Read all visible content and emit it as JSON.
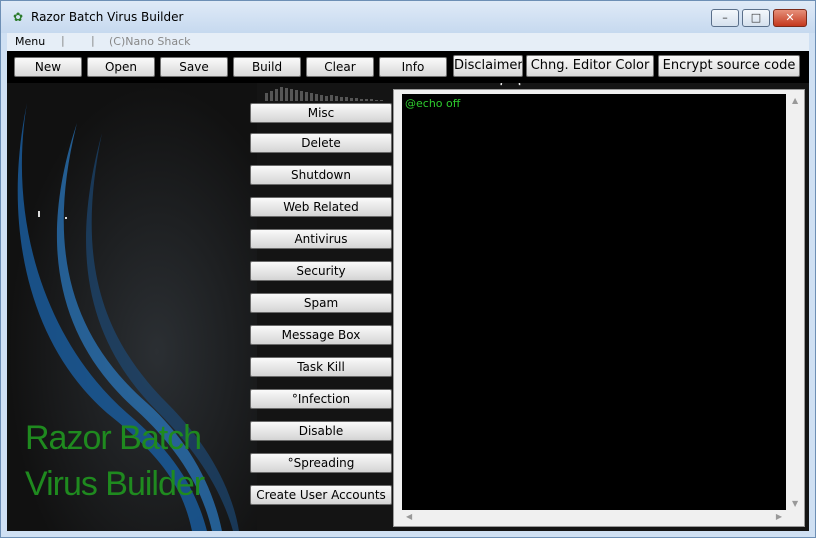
{
  "window": {
    "title": "Razor Batch Virus Builder",
    "controls": {
      "minimize": "–",
      "maximize": "□",
      "close": "✕"
    }
  },
  "menubar": {
    "menu": "Menu",
    "credit": "(C)Nano Shack"
  },
  "toolbar": {
    "buttons": [
      "New",
      "Open",
      "Save",
      "Build",
      "Clear",
      "Info"
    ],
    "disclaimer": "Disclaimer",
    "editor_color": "Chng. Editor Color",
    "encrypt": "Encrypt source code"
  },
  "side_buttons": [
    "Misc",
    "Delete",
    "Shutdown",
    "Web Related",
    "Antivirus",
    "Security",
    "Spam",
    "Message Box",
    "Task Kill",
    "°Infection",
    "Disable",
    "°Spreading",
    "Create User Accounts"
  ],
  "branding": {
    "line1": "Razor Batch",
    "line2": "Virus Builder"
  },
  "editor": {
    "content": "@echo off"
  },
  "colors": {
    "accent_green": "#1f8a1f",
    "editor_text": "#2ecc2e",
    "editor_bg": "#000000"
  }
}
